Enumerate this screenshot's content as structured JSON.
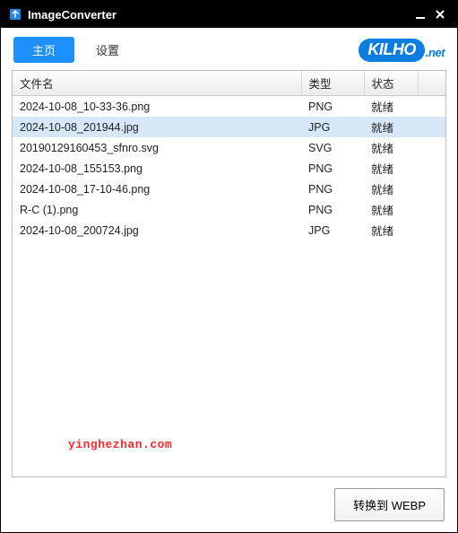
{
  "window": {
    "title": "ImageConverter"
  },
  "tabs": {
    "home": "主页",
    "settings": "设置"
  },
  "brand": {
    "name": "KILHO",
    "ext": ".net"
  },
  "table": {
    "headers": {
      "filename": "文件名",
      "type": "类型",
      "status": "状态"
    },
    "rows": [
      {
        "filename": "2024-10-08_10-33-36.png",
        "type": "PNG",
        "status": "就绪",
        "selected": false
      },
      {
        "filename": "2024-10-08_201944.jpg",
        "type": "JPG",
        "status": "就绪",
        "selected": true
      },
      {
        "filename": "20190129160453_sfnro.svg",
        "type": "SVG",
        "status": "就绪",
        "selected": false
      },
      {
        "filename": "2024-10-08_155153.png",
        "type": "PNG",
        "status": "就绪",
        "selected": false
      },
      {
        "filename": "2024-10-08_17-10-46.png",
        "type": "PNG",
        "status": "就绪",
        "selected": false
      },
      {
        "filename": "R-C (1).png",
        "type": "PNG",
        "status": "就绪",
        "selected": false
      },
      {
        "filename": "2024-10-08_200724.jpg",
        "type": "JPG",
        "status": "就绪",
        "selected": false
      }
    ]
  },
  "watermark": "yinghezhan.com",
  "footer": {
    "convert": "转换到 WEBP"
  }
}
